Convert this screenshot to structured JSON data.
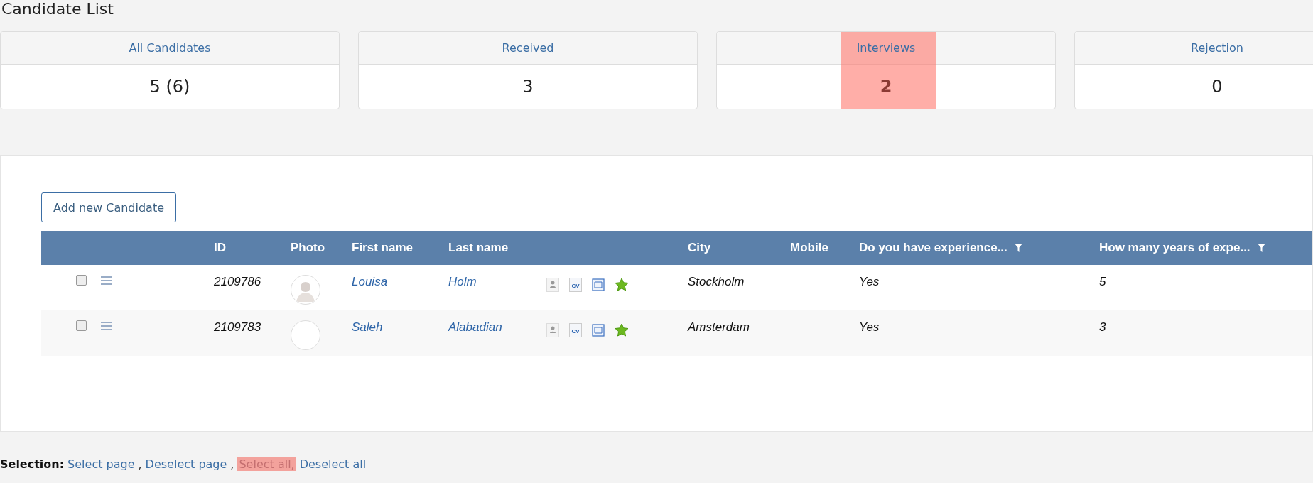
{
  "page": {
    "title": "Candidate List"
  },
  "stat_cards": [
    {
      "label": "All Candidates",
      "count": "5 (6)",
      "highlighted": false
    },
    {
      "label": "Received",
      "count": "3",
      "highlighted": false
    },
    {
      "label": "Interviews",
      "count": "2",
      "highlighted": true
    },
    {
      "label": "Rejection",
      "count": "0",
      "highlighted": false
    }
  ],
  "add_button": "Add new Candidate",
  "table": {
    "columns": [
      {
        "label": "ID",
        "filter": false
      },
      {
        "label": "Photo",
        "filter": false
      },
      {
        "label": "First name",
        "filter": false
      },
      {
        "label": "Last name",
        "filter": false
      },
      {
        "label": "City",
        "filter": false
      },
      {
        "label": "Mobile",
        "filter": false
      },
      {
        "label": "Do you have experience...",
        "filter": true
      },
      {
        "label": "How many years of expe...",
        "filter": true
      }
    ],
    "rows": [
      {
        "checked": false,
        "id": "2109786",
        "photo": true,
        "first_name": "Louisa",
        "last_name": "Holm",
        "cv_icon_text": "CV",
        "starred": true,
        "city": "Stockholm",
        "experience": "Yes",
        "years": "5"
      },
      {
        "checked": false,
        "id": "2109783",
        "photo": false,
        "first_name": "Saleh",
        "last_name": "Alabadian",
        "cv_icon_text": "CV",
        "starred": true,
        "city": "Amsterdam",
        "experience": "Yes",
        "years": "3"
      }
    ]
  },
  "selection": {
    "label": "Selection:",
    "items": [
      {
        "kind": "link",
        "text": "Select page",
        "highlighted": false
      },
      {
        "kind": "separator",
        "text": ","
      },
      {
        "kind": "link",
        "text": "Deselect page",
        "highlighted": false
      },
      {
        "kind": "separator",
        "text": ","
      },
      {
        "kind": "link",
        "text": "Select all,",
        "highlighted": true
      },
      {
        "kind": "link",
        "text": "Deselect all",
        "highlighted": false
      }
    ]
  }
}
